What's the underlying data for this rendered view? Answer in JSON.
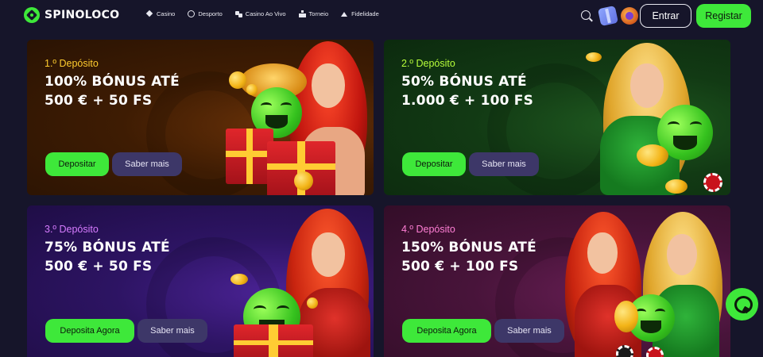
{
  "brand": {
    "name": "SPINOLOCO",
    "accent": "#3ee83a",
    "background": "#16152a"
  },
  "nav": [
    {
      "label": "Casino",
      "icon": "diamond-icon"
    },
    {
      "label": "Desporto",
      "icon": "ball-icon"
    },
    {
      "label": "Casino Ao Vivo",
      "icon": "cards-icon"
    },
    {
      "label": "Torneio",
      "icon": "trophy-icon"
    },
    {
      "label": "Fidelidade",
      "icon": "crown-icon"
    }
  ],
  "header": {
    "login_label": "Entrar",
    "register_label": "Registar"
  },
  "promos": [
    {
      "deposit": "1.º Depósito",
      "line1": "100% BÓNUS ATÉ",
      "line2": "500 € + 50 FS",
      "cta": "Depositar",
      "more": "Saber mais",
      "theme": "#ffcc2e"
    },
    {
      "deposit": "2.º Depósito",
      "line1": "50% BÓNUS ATÉ",
      "line2": "1.000 € + 100 FS",
      "cta": "Depositar",
      "more": "Saber mais",
      "theme": "#b8ff3a"
    },
    {
      "deposit": "3.º Depósito",
      "line1": "75% BÓNUS ATÉ",
      "line2": "500 € + 50 FS",
      "cta": "Deposita Agora",
      "more": "Saber mais",
      "theme": "#d77cff"
    },
    {
      "deposit": "4.º Depósito",
      "line1": "150% BÓNUS ATÉ",
      "line2": "500 € + 100 FS",
      "cta": "Deposita Agora",
      "more": "Saber mais",
      "theme": "#ff7fd5"
    }
  ]
}
